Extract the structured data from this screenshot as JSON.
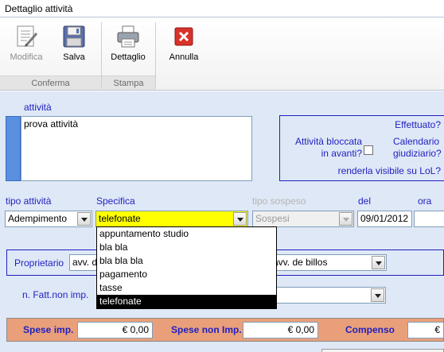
{
  "window": {
    "title": "Dettaglio attività"
  },
  "ribbon": {
    "buttons": {
      "modifica": "Modifica",
      "salva": "Salva",
      "dettaglio": "Dettaglio",
      "annulla": "Annulla"
    },
    "groups": {
      "conferma": "Conferma",
      "stampa": "Stampa"
    }
  },
  "form": {
    "attivita_label": "attività",
    "attivita_value": "prova attività",
    "effettuato_label": "Effettuato?",
    "bloccata_label_line1": "Attività bloccata",
    "bloccata_label_line2": "in avanti?",
    "calendario_label_line1": "Calendario",
    "calendario_label_line2": "giudiziario?",
    "visibile_label": "renderla visibile su LoL?",
    "tipo_attivita_label": "tipo attività",
    "tipo_attivita_value": "Adempimento",
    "specifica_label": "Specifica",
    "specifica_value": "telefonate",
    "tipo_sospeso_label": "tipo sospeso",
    "tipo_sospeso_value": "Sospesi",
    "del_label": "del",
    "del_value": "09/01/2012",
    "ora_label": "ora",
    "proprietario_label": "Proprietario",
    "proprietario_value": "avv. d",
    "avv_value": "avv. de billos",
    "nfatt_label": "n. Fatt.non imp.",
    "spese_imp_label": "Spese imp.",
    "spese_imp_value": "€ 0,00",
    "spese_non_imp_label": "Spese non Imp.",
    "spese_non_imp_value": "€ 0,00",
    "compenso_label": "Compenso",
    "compenso_value": "€"
  },
  "specifica_dropdown": {
    "options": [
      "appuntamento studio",
      "bla bla",
      "bla bla bla",
      "pagamento",
      "tasse",
      "telefonate"
    ],
    "selected": "telefonate"
  },
  "colors": {
    "label_blue": "#1f1fbf",
    "form_background": "#dfe8f6",
    "highlight_yellow": "#ffff00",
    "bottom_bar": "#e9a07a"
  },
  "icons": {
    "modifica": "edit-document-icon",
    "salva": "floppy-disk-icon",
    "dettaglio": "printer-icon",
    "annulla": "close-icon"
  }
}
